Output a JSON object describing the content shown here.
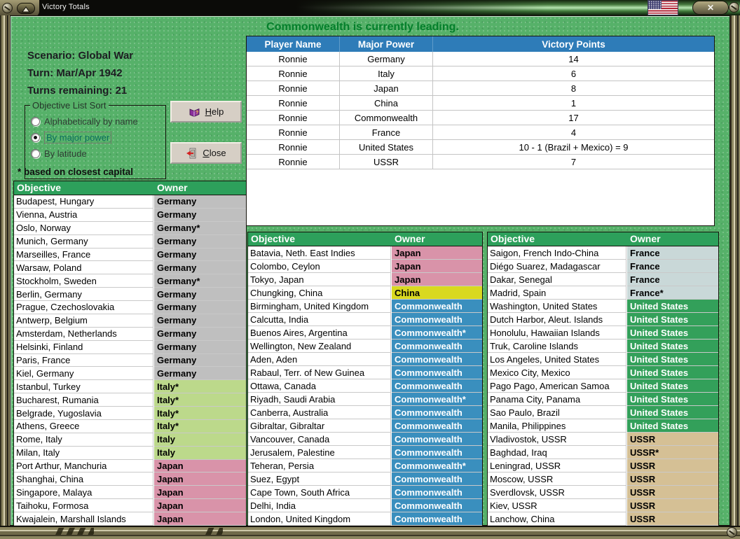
{
  "window": {
    "title": "Victory Totals",
    "close_glyph": "✕"
  },
  "status": {
    "message": "Commonwealth is currently leading."
  },
  "scenario": {
    "lines": [
      "Scenario: Global War",
      "Turn: Mar/Apr 1942",
      "Turns remaining: 21"
    ]
  },
  "sort_box": {
    "legend": "Objective List Sort",
    "options": [
      {
        "label": "Alphabetically by name",
        "selected": false
      },
      {
        "label": "By major power",
        "selected": true
      },
      {
        "label": "By latitude",
        "selected": false
      }
    ]
  },
  "buttons": {
    "help_initial": "H",
    "help_rest": "elp",
    "close_initial": "C",
    "close_rest": "lose"
  },
  "footnote": "* based on closest capital",
  "victory_table": {
    "headers": [
      "Player Name",
      "Major Power",
      "Victory Points"
    ],
    "rows": [
      [
        "Ronnie",
        "Germany",
        "14"
      ],
      [
        "Ronnie",
        "Italy",
        "6"
      ],
      [
        "Ronnie",
        "Japan",
        "8"
      ],
      [
        "Ronnie",
        "China",
        "1"
      ],
      [
        "Ronnie",
        "Commonwealth",
        "17"
      ],
      [
        "Ronnie",
        "France",
        "4"
      ],
      [
        "Ronnie",
        "United States",
        "10 - 1 (Brazil + Mexico) = 9"
      ],
      [
        "Ronnie",
        "USSR",
        "7"
      ]
    ]
  },
  "objective_tables": {
    "headers": [
      "Objective",
      "Owner"
    ],
    "left": [
      {
        "objective": "Budapest, Hungary",
        "owner": "Germany",
        "power": "germany"
      },
      {
        "objective": "Vienna, Austria",
        "owner": "Germany",
        "power": "germany"
      },
      {
        "objective": "Oslo, Norway",
        "owner": "Germany*",
        "power": "germany"
      },
      {
        "objective": "Munich, Germany",
        "owner": "Germany",
        "power": "germany"
      },
      {
        "objective": "Marseilles, France",
        "owner": "Germany",
        "power": "germany"
      },
      {
        "objective": "Warsaw, Poland",
        "owner": "Germany",
        "power": "germany"
      },
      {
        "objective": "Stockholm, Sweden",
        "owner": "Germany*",
        "power": "germany"
      },
      {
        "objective": "Berlin, Germany",
        "owner": "Germany",
        "power": "germany"
      },
      {
        "objective": "Prague, Czechoslovakia",
        "owner": "Germany",
        "power": "germany"
      },
      {
        "objective": "Antwerp, Belgium",
        "owner": "Germany",
        "power": "germany"
      },
      {
        "objective": "Amsterdam, Netherlands",
        "owner": "Germany",
        "power": "germany"
      },
      {
        "objective": "Helsinki, Finland",
        "owner": "Germany",
        "power": "germany"
      },
      {
        "objective": "Paris, France",
        "owner": "Germany",
        "power": "germany"
      },
      {
        "objective": "Kiel, Germany",
        "owner": "Germany",
        "power": "germany"
      },
      {
        "objective": "Istanbul, Turkey",
        "owner": "Italy*",
        "power": "italy"
      },
      {
        "objective": "Bucharest, Rumania",
        "owner": "Italy*",
        "power": "italy"
      },
      {
        "objective": "Belgrade, Yugoslavia",
        "owner": "Italy*",
        "power": "italy"
      },
      {
        "objective": "Athens, Greece",
        "owner": "Italy*",
        "power": "italy"
      },
      {
        "objective": "Rome, Italy",
        "owner": "Italy",
        "power": "italy"
      },
      {
        "objective": "Milan, Italy",
        "owner": "Italy",
        "power": "italy"
      },
      {
        "objective": "Port Arthur, Manchuria",
        "owner": "Japan",
        "power": "japan"
      },
      {
        "objective": "Shanghai, China",
        "owner": "Japan",
        "power": "japan"
      },
      {
        "objective": "Singapore, Malaya",
        "owner": "Japan",
        "power": "japan"
      },
      {
        "objective": "Taihoku, Formosa",
        "owner": "Japan",
        "power": "japan"
      },
      {
        "objective": "Kwajalein, Marshall Islands",
        "owner": "Japan",
        "power": "japan"
      }
    ],
    "middle": [
      {
        "objective": "Batavia, Neth. East Indies",
        "owner": "Japan",
        "power": "japan"
      },
      {
        "objective": "Colombo, Ceylon",
        "owner": "Japan",
        "power": "japan"
      },
      {
        "objective": "Tokyo, Japan",
        "owner": "Japan",
        "power": "japan"
      },
      {
        "objective": "Chungking, China",
        "owner": "China",
        "power": "china"
      },
      {
        "objective": "Birmingham, United Kingdom",
        "owner": "Commonwealth",
        "power": "commonwealth"
      },
      {
        "objective": "Calcutta, India",
        "owner": "Commonwealth",
        "power": "commonwealth"
      },
      {
        "objective": "Buenos Aires, Argentina",
        "owner": "Commonwealth*",
        "power": "commonwealth"
      },
      {
        "objective": "Wellington, New Zealand",
        "owner": "Commonwealth",
        "power": "commonwealth"
      },
      {
        "objective": "Aden, Aden",
        "owner": "Commonwealth",
        "power": "commonwealth"
      },
      {
        "objective": "Rabaul, Terr. of New Guinea",
        "owner": "Commonwealth",
        "power": "commonwealth"
      },
      {
        "objective": "Ottawa, Canada",
        "owner": "Commonwealth",
        "power": "commonwealth"
      },
      {
        "objective": "Riyadh, Saudi Arabia",
        "owner": "Commonwealth*",
        "power": "commonwealth"
      },
      {
        "objective": "Canberra, Australia",
        "owner": "Commonwealth",
        "power": "commonwealth"
      },
      {
        "objective": "Gibraltar, Gibraltar",
        "owner": "Commonwealth",
        "power": "commonwealth"
      },
      {
        "objective": "Vancouver, Canada",
        "owner": "Commonwealth",
        "power": "commonwealth"
      },
      {
        "objective": "Jerusalem, Palestine",
        "owner": "Commonwealth",
        "power": "commonwealth"
      },
      {
        "objective": "Teheran, Persia",
        "owner": "Commonwealth*",
        "power": "commonwealth"
      },
      {
        "objective": "Suez, Egypt",
        "owner": "Commonwealth",
        "power": "commonwealth"
      },
      {
        "objective": "Cape Town, South Africa",
        "owner": "Commonwealth",
        "power": "commonwealth"
      },
      {
        "objective": "Delhi, India",
        "owner": "Commonwealth",
        "power": "commonwealth"
      },
      {
        "objective": "London, United Kingdom",
        "owner": "Commonwealth",
        "power": "commonwealth"
      }
    ],
    "right": [
      {
        "objective": "Saigon, French Indo-China",
        "owner": "France",
        "power": "france"
      },
      {
        "objective": "Diégo Suarez, Madagascar",
        "owner": "France",
        "power": "france"
      },
      {
        "objective": "Dakar, Senegal",
        "owner": "France",
        "power": "france"
      },
      {
        "objective": "Madrid, Spain",
        "owner": "France*",
        "power": "france"
      },
      {
        "objective": "Washington, United States",
        "owner": "United States",
        "power": "united_states"
      },
      {
        "objective": "Dutch Harbor, Aleut. Islands",
        "owner": "United States",
        "power": "united_states"
      },
      {
        "objective": "Honolulu, Hawaiian Islands",
        "owner": "United States",
        "power": "united_states"
      },
      {
        "objective": "Truk, Caroline Islands",
        "owner": "United States",
        "power": "united_states"
      },
      {
        "objective": "Los Angeles, United States",
        "owner": "United States",
        "power": "united_states"
      },
      {
        "objective": "Mexico City, Mexico",
        "owner": "United States",
        "power": "united_states"
      },
      {
        "objective": "Pago Pago, American Samoa",
        "owner": "United States",
        "power": "united_states"
      },
      {
        "objective": "Panama City, Panama",
        "owner": "United States",
        "power": "united_states"
      },
      {
        "objective": "Sao Paulo, Brazil",
        "owner": "United States",
        "power": "united_states"
      },
      {
        "objective": "Manila, Philippines",
        "owner": "United States",
        "power": "united_states"
      },
      {
        "objective": "Vladivostok, USSR",
        "owner": "USSR",
        "power": "ussr"
      },
      {
        "objective": "Baghdad, Iraq",
        "owner": "USSR*",
        "power": "ussr"
      },
      {
        "objective": "Leningrad, USSR",
        "owner": "USSR",
        "power": "ussr"
      },
      {
        "objective": "Moscow, USSR",
        "owner": "USSR",
        "power": "ussr"
      },
      {
        "objective": "Sverdlovsk, USSR",
        "owner": "USSR",
        "power": "ussr"
      },
      {
        "objective": "Kiev, USSR",
        "owner": "USSR",
        "power": "ussr"
      },
      {
        "objective": "Lanchow, China",
        "owner": "USSR",
        "power": "ussr"
      }
    ]
  },
  "power_colors": {
    "germany": {
      "bg": "#bfbfbf",
      "fg": "#000000"
    },
    "italy": {
      "bg": "#bcd98b",
      "fg": "#000000"
    },
    "japan": {
      "bg": "#d993a9",
      "fg": "#000000"
    },
    "china": {
      "bg": "#d9d920",
      "fg": "#000000"
    },
    "commonwealth": {
      "bg": "#3a8fbe",
      "fg": "#ffffff"
    },
    "france": {
      "bg": "#c9d8d8",
      "fg": "#000000"
    },
    "united_states": {
      "bg": "#33a05a",
      "fg": "#ffffff"
    },
    "ussr": {
      "bg": "#d5c095",
      "fg": "#000000"
    }
  },
  "colors": {
    "status_green": "#047f2b",
    "victory_header_blue": "#2e7cb8",
    "objective_header_green": "#2da05b",
    "background_green": "#56b169"
  }
}
